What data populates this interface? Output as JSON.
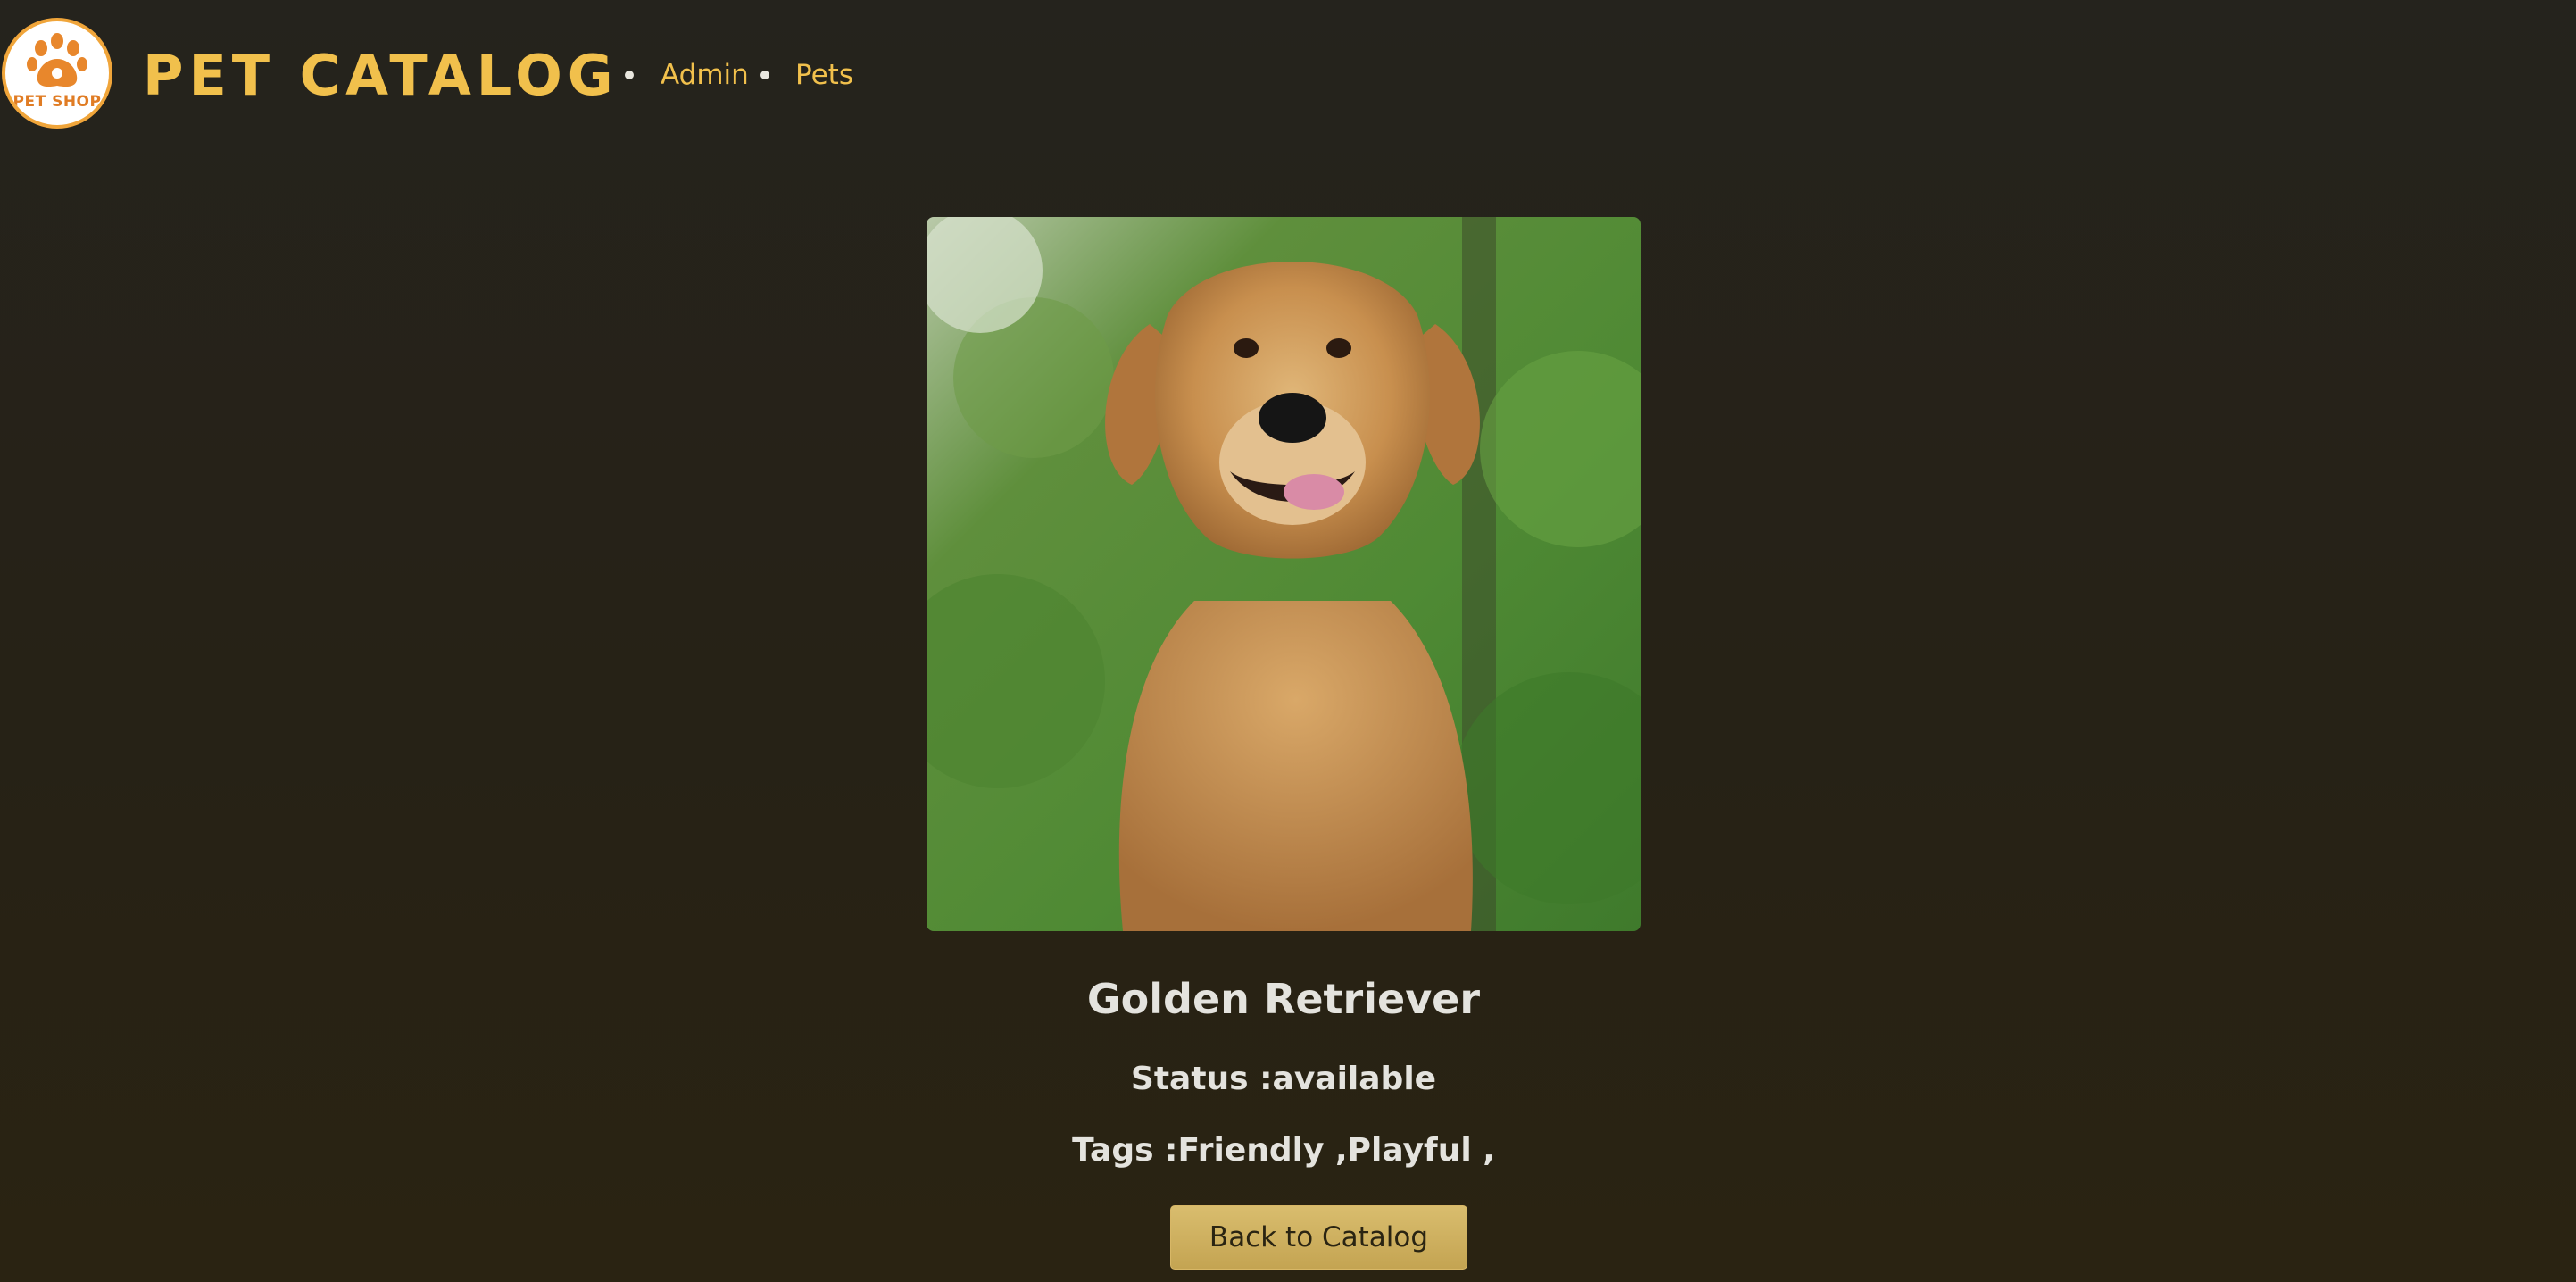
{
  "header": {
    "logo_text": "PET SHOP",
    "title": "PET CATALOG",
    "nav": [
      {
        "label": "Admin"
      },
      {
        "label": "Pets"
      }
    ]
  },
  "pet": {
    "image_alt": "dog-photo",
    "name": "Golden Retriever",
    "status_line": "Status :available",
    "tags_line": "Tags :Friendly ,Playful ,"
  },
  "actions": {
    "back_label": "Back to Catalog"
  },
  "colors": {
    "accent": "#f1c04c",
    "logo_orange": "#f0a53a",
    "button": "#cdae5e",
    "text": "#e4e3de"
  },
  "icons": {
    "logo": "paw-print-icon",
    "nav_bullet": "bullet-dot-icon"
  }
}
